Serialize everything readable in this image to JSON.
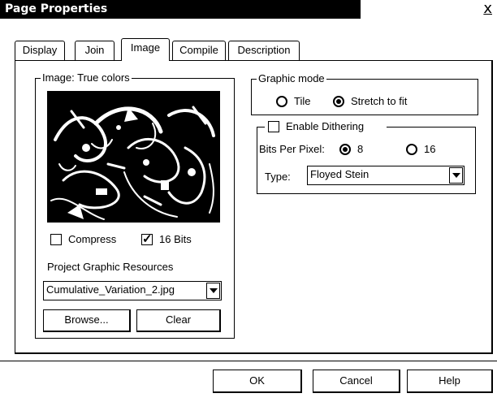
{
  "window": {
    "title": "Page Properties",
    "close_label": "x"
  },
  "tabs": [
    {
      "label": "Display"
    },
    {
      "label": "Join"
    },
    {
      "label": "Image",
      "active": true
    },
    {
      "label": "Compile"
    },
    {
      "label": "Description"
    }
  ],
  "image_group": {
    "legend": "Image: True colors",
    "compress": {
      "label": "Compress",
      "checked": false
    },
    "bits16": {
      "label": "16 Bits",
      "checked": true
    },
    "resources_label": "Project Graphic Resources",
    "resource_select": {
      "value": "Cumulative_Variation_2.jpg"
    },
    "browse_label": "Browse...",
    "clear_label": "Clear"
  },
  "graphic_mode": {
    "legend": "Graphic mode",
    "tile": {
      "label": "Tile",
      "selected": false
    },
    "stretch": {
      "label": "Stretch to fit",
      "selected": true
    }
  },
  "dithering": {
    "enable": {
      "label": "Enable Dithering",
      "checked": false
    },
    "bits_label": "Bits Per Pixel:",
    "bits8": {
      "label": "8",
      "selected": true
    },
    "bits16": {
      "label": "16",
      "selected": false
    },
    "type_label": "Type:",
    "type_select": {
      "value": "Floyed Stein"
    }
  },
  "buttons": {
    "ok": "OK",
    "cancel": "Cancel",
    "help": "Help"
  }
}
